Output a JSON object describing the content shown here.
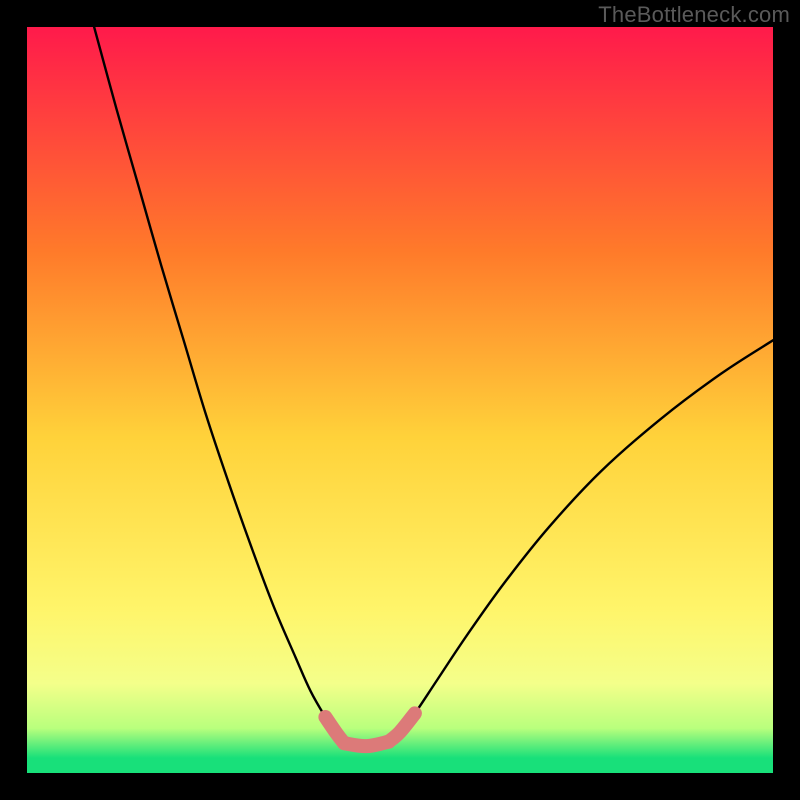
{
  "watermark": "TheBottleneck.com",
  "colors": {
    "frame": "#000000",
    "watermark_text": "#5a5a5a",
    "gradient_top": "#ff1a4b",
    "gradient_mid1": "#ff7a2a",
    "gradient_mid2": "#ffd23a",
    "gradient_mid3": "#fff56a",
    "gradient_band": "#f4ff8a",
    "gradient_green": "#18e07a",
    "curve_stroke": "#000000",
    "highlight_stroke": "#dc7a79"
  },
  "chart_data": {
    "type": "line",
    "title": "",
    "xlabel": "",
    "ylabel": "",
    "xlim": [
      0,
      100
    ],
    "ylim": [
      0,
      100
    ],
    "series": [
      {
        "name": "left-curve",
        "x": [
          9,
          12,
          15,
          18,
          21,
          24,
          27,
          30,
          33,
          36,
          38,
          40,
          41.5,
          42.5
        ],
        "y": [
          100,
          89,
          78.5,
          68,
          58,
          48,
          39,
          30.5,
          22.5,
          15.5,
          11,
          7.5,
          5.3,
          4
        ]
      },
      {
        "name": "right-curve",
        "x": [
          48.5,
          50,
          52,
          55,
          59,
          64,
          70,
          77,
          85,
          93,
          100
        ],
        "y": [
          4.2,
          5.5,
          8,
          12.5,
          18.5,
          25.5,
          33,
          40.5,
          47.5,
          53.5,
          58
        ]
      },
      {
        "name": "highlight-left",
        "x": [
          40,
          41.5,
          42.5
        ],
        "y": [
          7.5,
          5.3,
          4
        ]
      },
      {
        "name": "highlight-bottom",
        "x": [
          42.5,
          45.5,
          48.5
        ],
        "y": [
          4,
          3.6,
          4.2
        ]
      },
      {
        "name": "highlight-right",
        "x": [
          48.5,
          50,
          52
        ],
        "y": [
          4.2,
          5.5,
          8
        ]
      }
    ],
    "gradient_stops": [
      {
        "offset": 0.0,
        "color": "#ff1a4b"
      },
      {
        "offset": 0.3,
        "color": "#ff7a2a"
      },
      {
        "offset": 0.55,
        "color": "#ffd23a"
      },
      {
        "offset": 0.78,
        "color": "#fff56a"
      },
      {
        "offset": 0.88,
        "color": "#f4ff8a"
      },
      {
        "offset": 0.94,
        "color": "#b9ff7d"
      },
      {
        "offset": 0.98,
        "color": "#18e07a"
      },
      {
        "offset": 1.0,
        "color": "#18e07a"
      }
    ]
  }
}
